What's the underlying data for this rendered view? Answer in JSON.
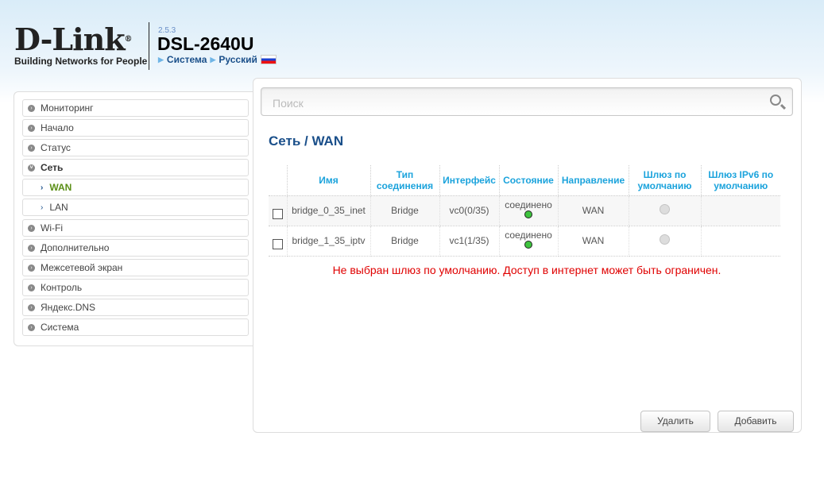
{
  "header": {
    "brand": "D-Link",
    "tagline": "Building Networks for People",
    "version": "2.5.3",
    "model": "DSL-2640U",
    "crumbs": [
      "Система",
      "Русский"
    ]
  },
  "search": {
    "placeholder": "Поиск"
  },
  "sidebar": {
    "items": [
      {
        "label": "Мониторинг"
      },
      {
        "label": "Начало"
      },
      {
        "label": "Статус"
      },
      {
        "label": "Сеть"
      },
      {
        "label": "WAN"
      },
      {
        "label": "LAN"
      },
      {
        "label": "Wi-Fi"
      },
      {
        "label": "Дополнительно"
      },
      {
        "label": "Межсетевой экран"
      },
      {
        "label": "Контроль"
      },
      {
        "label": "Яндекс.DNS"
      },
      {
        "label": "Система"
      }
    ]
  },
  "page": {
    "title": "Сеть /  WAN"
  },
  "table": {
    "headers": [
      "Имя",
      "Тип соединения",
      "Интерфейс",
      "Состояние",
      "Направление",
      "Шлюз по умолчанию",
      "Шлюз IPv6 по умолчанию"
    ],
    "rows": [
      {
        "name": "bridge_0_35_inet",
        "type": "Bridge",
        "iface": "vc0(0/35)",
        "state": "соединено",
        "direction": "WAN"
      },
      {
        "name": "bridge_1_35_iptv",
        "type": "Bridge",
        "iface": "vc1(1/35)",
        "state": "соединено",
        "direction": "WAN"
      }
    ]
  },
  "warning": "Не выбран шлюз по умолчанию. Доступ в интернет может быть ограничен.",
  "buttons": {
    "delete": "Удалить",
    "add": "Добавить"
  }
}
